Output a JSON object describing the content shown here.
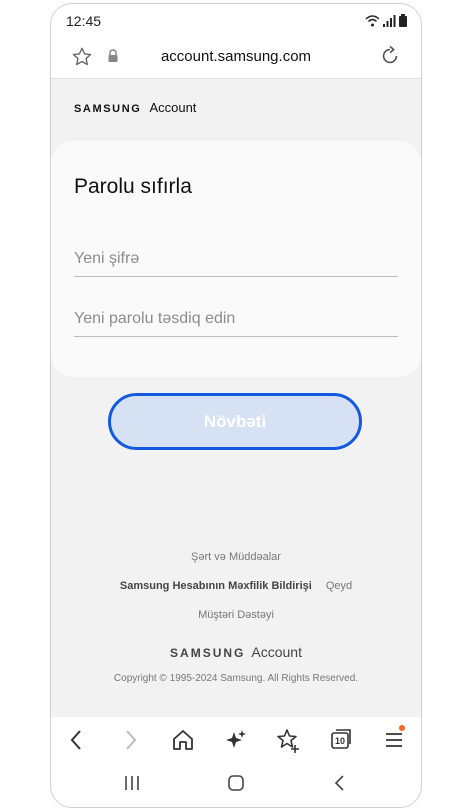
{
  "status_bar": {
    "time": "12:45"
  },
  "browser": {
    "url": "account.samsung.com"
  },
  "brand": {
    "samsung": "SAMSUNG",
    "account": "Account"
  },
  "form": {
    "title": "Parolu sıfırla",
    "new_password_placeholder": "Yeni şifrə",
    "confirm_password_placeholder": "Yeni parolu təsdiq edin",
    "next_label": "Növbəti"
  },
  "footer": {
    "terms": "Şərt və Müddəalar",
    "privacy": "Samsung Hesabının Məxfilik Bildirişi",
    "note": "Qeyd",
    "support": "Müştəri Dəstəyi",
    "brand_samsung": "SAMSUNG",
    "brand_account": "Account",
    "copyright": "Copyright © 1995-2024 Samsung. All Rights Reserved."
  },
  "toolbar": {
    "tabs_count": "10"
  },
  "colors": {
    "accent": "#1259e0",
    "button_fill": "#d6e2f3",
    "notification_dot": "#f26b1d"
  }
}
